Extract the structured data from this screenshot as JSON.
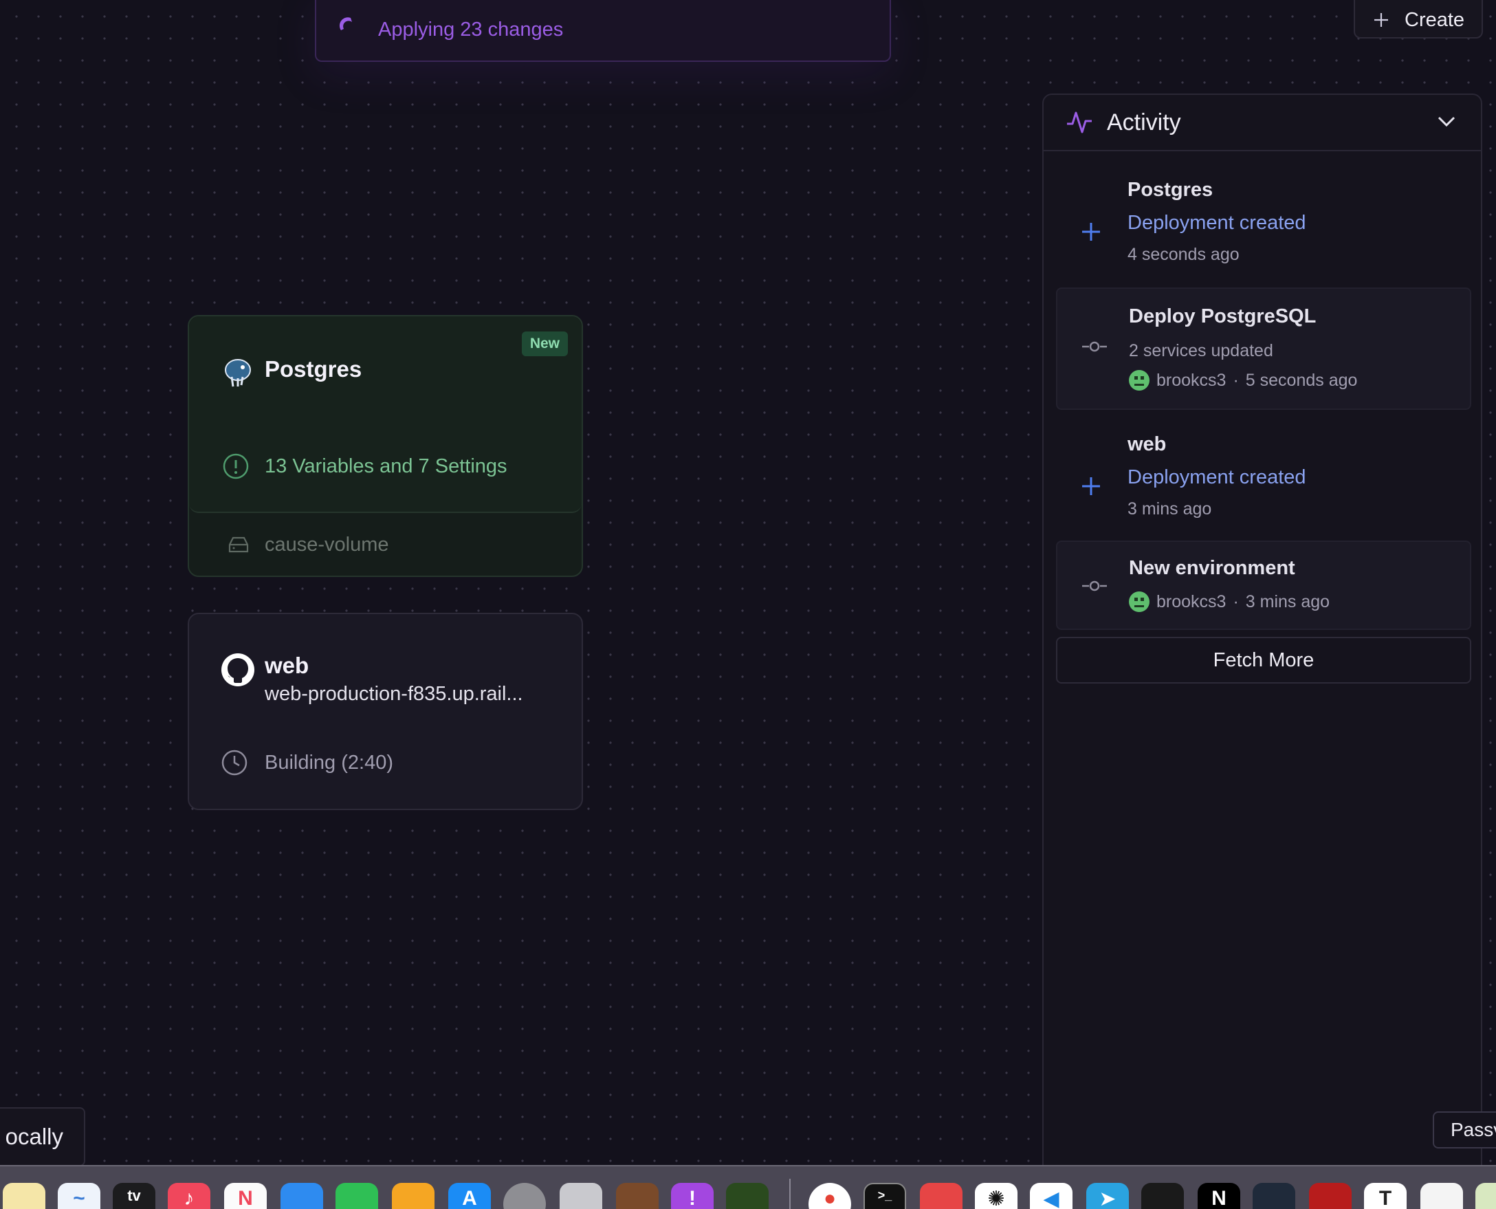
{
  "banner": {
    "label": "Applying 23 changes"
  },
  "toolbar": {
    "create_label": "Create"
  },
  "services": {
    "postgres": {
      "name": "Postgres",
      "badge": "New",
      "pending": "13 Variables and 7 Settings",
      "volume": "cause-volume"
    },
    "web": {
      "name": "web",
      "domain": "web-production-f835.up.rail...",
      "status": "Building (2:40)"
    }
  },
  "activity": {
    "title": "Activity",
    "items": [
      {
        "name": "Postgres",
        "desc": "Deployment created",
        "time": "4 seconds ago"
      },
      {
        "name": "Deploy PostgreSQL",
        "sub": "2 services updated",
        "user": "brookcs3",
        "time": "5 seconds ago"
      },
      {
        "name": "web",
        "desc": "Deployment created",
        "time": "3 mins ago"
      },
      {
        "name": "New environment",
        "user": "brookcs3",
        "time": "3 mins ago"
      }
    ],
    "fetch_more": "Fetch More",
    "sep": "·"
  },
  "snippets": {
    "locally": "ocally",
    "passw": "Passv"
  },
  "dock": {
    "icons": [
      "notes-icon",
      "freeform-icon",
      "apple-tv-icon",
      "music-icon",
      "news-icon",
      "keynote-icon",
      "numbers-icon",
      "pages-icon",
      "app-store-icon",
      "system-settings-icon",
      "iphone-mirroring-icon",
      "app-icon",
      "feedback-icon",
      "app-icon",
      "chrome-icon",
      "terminal-icon",
      "app-icon",
      "chatgpt-icon",
      "vscode-icon",
      "telegram-icon",
      "app-icon",
      "notion-icon",
      "app-icon",
      "acrobat-icon",
      "typora-icon",
      "textedit-icon",
      "app-icon"
    ]
  },
  "colors": {
    "accent": "#9b5de5",
    "link": "#8aa2f0",
    "success": "#6fcf97"
  }
}
